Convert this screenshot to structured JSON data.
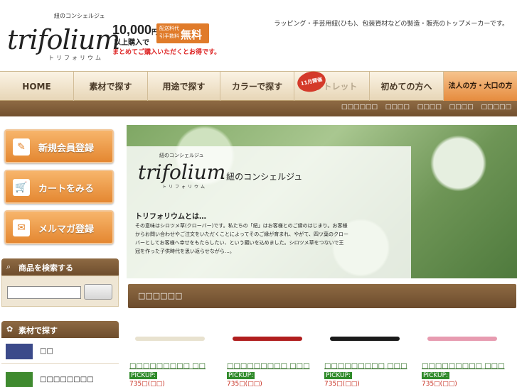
{
  "header": {
    "logo_tag": "紐のコンシェルジュ",
    "logo_word": "trifolium",
    "logo_kana": "トリフォリウム",
    "promo_amount": "10,000",
    "promo_yen": "円",
    "promo_sub": "以上購入で",
    "promo_small": "配送料代引手数料",
    "promo_free": "無料",
    "promo_note": "まとめてご購入いただくとお得です。",
    "tagline": "ラッピング・手芸用紐(ひも)、包装資材などの製造・販売のトップメーカーです。"
  },
  "nav": {
    "items": [
      {
        "label": "HOME"
      },
      {
        "label": "素材で探す"
      },
      {
        "label": "用途で探す"
      },
      {
        "label": "カラーで探す"
      },
      {
        "label": "アウトレット"
      },
      {
        "label": "初めての方へ"
      },
      {
        "label": "法人の方・大口の方"
      }
    ],
    "badge": "11月開催"
  },
  "subbar": {
    "links": [
      "□□□□□□",
      "□□□□",
      "□□□□",
      "□□□□",
      "□□□□□"
    ]
  },
  "sidebar": {
    "buttons": [
      {
        "label": "新規会員登録",
        "icon": "pencil-icon"
      },
      {
        "label": "カートをみる",
        "icon": "cart-icon"
      },
      {
        "label": "メルマガ登録",
        "icon": "envelope-icon"
      }
    ],
    "search_heading": "商品を検索する",
    "search_placeholder": "",
    "search_button": "",
    "material_heading": "素材で探す",
    "materials": [
      {
        "label": "□□",
        "color": "#3b4a8a"
      },
      {
        "label": "□□□□□□□□",
        "color": "#3f8a2f"
      }
    ]
  },
  "hero": {
    "logo_tag": "紐のコンシェルジュ",
    "logo_word": "trifolium",
    "logo_kana": "トリフォリウム",
    "subtitle": "-  紐のコンシェルジュ",
    "title": "トリフォリウムとは…",
    "body": "その意味はシロツメ草(クローバー)です。私たちの「紐」はお客様とのご縁のはじまり。お客様からお問い合わせやご注文をいただくことによってそのご縁が育まれ、やがて、四ツ葉のクローバーとしてお客様へ幸せをもたらしたい、という願いを込めました。シロツメ草をつないで王冠を作った子供時代を思い返らせながら…。"
  },
  "pickup": {
    "heading": "□□□□□□",
    "products": [
      {
        "name": "□□□□□□□□□ □□",
        "pick": "PICKUP:",
        "price": "735□(□□)",
        "color": "#e8e2cf"
      },
      {
        "name": "□□□□□□□□□ □□□",
        "pick": "PICKUP:",
        "price": "735□(□□)",
        "color": "#b01e1e"
      },
      {
        "name": "□□□□□□□□□ □□□",
        "pick": "PICKUP:",
        "price": "735□(□□)",
        "color": "#1a1a1a"
      },
      {
        "name": "□□□□□□□□□ □□□",
        "pick": "PICKUP:",
        "price": "735□(□□)",
        "color": "#e79bb0"
      }
    ]
  }
}
